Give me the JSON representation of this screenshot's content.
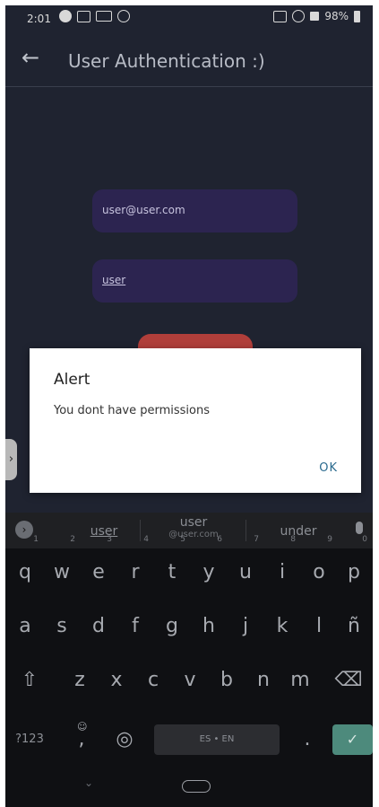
{
  "status_bar": {
    "time": "2:01",
    "battery": "98%"
  },
  "app_bar": {
    "back_icon": "arrow-left-icon",
    "title": "User Authentication :)"
  },
  "form": {
    "email_value": "user@user.com",
    "password_value": "user"
  },
  "dialog": {
    "title": "Alert",
    "message": "You dont have permissions",
    "ok_label": "OK"
  },
  "side_tab": {
    "icon": "chevron-right-icon"
  },
  "keyboard": {
    "suggestions": {
      "first": "user",
      "middle_main": "user",
      "middle_sub": "@user.com",
      "last": "under"
    },
    "row1": [
      {
        "key": "q",
        "hint": "1"
      },
      {
        "key": "w",
        "hint": "2"
      },
      {
        "key": "e",
        "hint": "3"
      },
      {
        "key": "r",
        "hint": "4"
      },
      {
        "key": "t",
        "hint": "5"
      },
      {
        "key": "y",
        "hint": "6"
      },
      {
        "key": "u",
        "hint": "7"
      },
      {
        "key": "i",
        "hint": "8"
      },
      {
        "key": "o",
        "hint": "9"
      },
      {
        "key": "p",
        "hint": "0"
      }
    ],
    "row2": [
      "a",
      "s",
      "d",
      "f",
      "g",
      "h",
      "j",
      "k",
      "l",
      "ñ"
    ],
    "row3": [
      "z",
      "x",
      "c",
      "v",
      "b",
      "n",
      "m"
    ],
    "symbols_label": "?123",
    "comma_label": ",",
    "space_label": "ES • EN",
    "period_label": ".",
    "enter_icon": "check-icon"
  },
  "colors": {
    "background": "#1f2330",
    "field": "#2c2450",
    "button": "#c0413c",
    "dialog_action": "#2a6a8e",
    "enter_key": "#4d8a7c"
  }
}
